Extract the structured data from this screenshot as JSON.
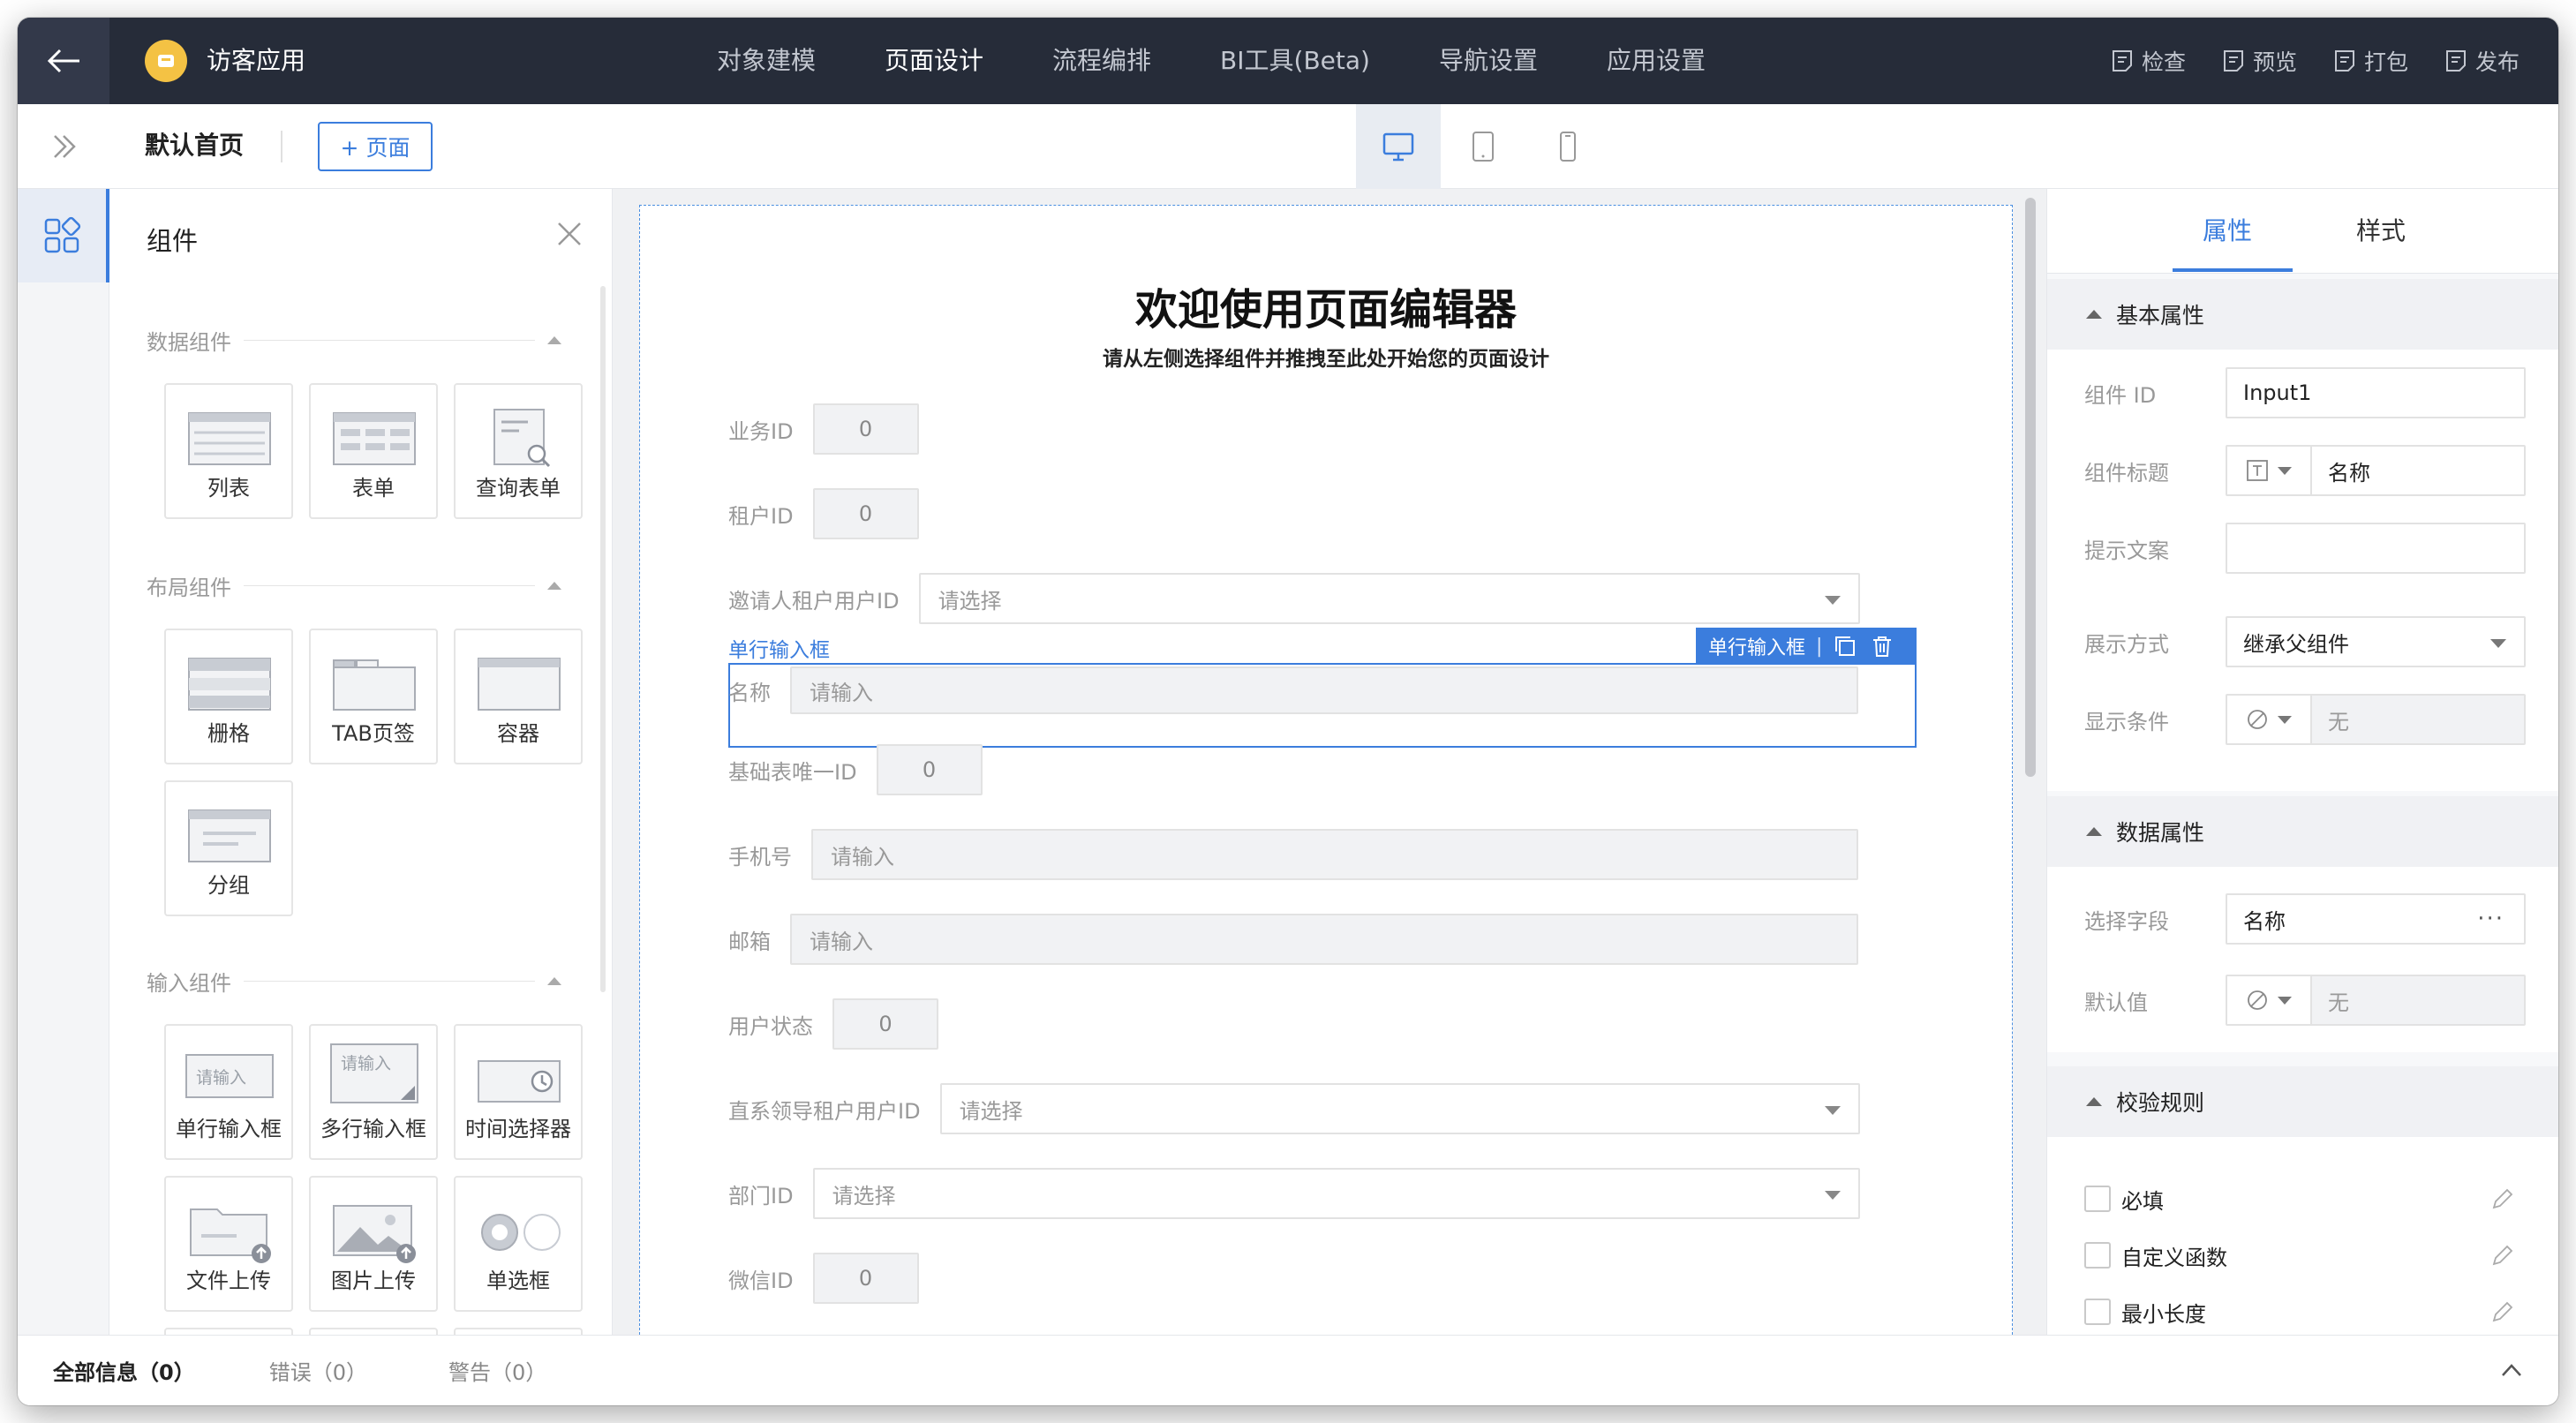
{
  "app": {
    "name": "访客应用"
  },
  "top_nav": [
    {
      "label": "对象建模",
      "active": false
    },
    {
      "label": "页面设计",
      "active": true
    },
    {
      "label": "流程编排",
      "active": false
    },
    {
      "label": "BI工具(Beta)",
      "active": false
    },
    {
      "label": "导航设置",
      "active": false
    },
    {
      "label": "应用设置",
      "active": false
    }
  ],
  "top_actions": [
    "检查",
    "预览",
    "打包",
    "发布"
  ],
  "subbar": {
    "page_name": "默认首页",
    "add_page_label": "+ 页面",
    "devices": [
      "desktop-icon",
      "tablet-icon",
      "mobile-icon"
    ]
  },
  "components_panel": {
    "title": "组件",
    "sections": [
      {
        "name": "数据组件",
        "items": [
          "列表",
          "表单",
          "查询表单"
        ]
      },
      {
        "name": "布局组件",
        "items": [
          "栅格",
          "TAB页签",
          "容器",
          "分组"
        ]
      },
      {
        "name": "输入组件",
        "items": [
          "单行输入框",
          "多行输入框",
          "时间选择器",
          "文件上传",
          "图片上传",
          "单选框"
        ]
      }
    ],
    "input_placeholder": "请输入"
  },
  "canvas": {
    "title": "欢迎使用页面编辑器",
    "subtitle": "请从左侧选择组件并推拽至此处开始您的页面设计",
    "selected_component_label": "单行输入框",
    "selected_toolbar_label": "单行输入框",
    "fields": [
      {
        "label": "业务ID",
        "kind": "number",
        "value": "0"
      },
      {
        "label": "租户ID",
        "kind": "number",
        "value": "0"
      },
      {
        "label": "邀请人租户用户ID",
        "kind": "select",
        "value": "请选择"
      },
      {
        "label": "名称",
        "kind": "text",
        "value": "请输入"
      },
      {
        "label": "基础表唯一ID",
        "kind": "number",
        "value": "0"
      },
      {
        "label": "手机号",
        "kind": "text",
        "value": "请输入"
      },
      {
        "label": "邮箱",
        "kind": "text",
        "value": "请输入"
      },
      {
        "label": "用户状态",
        "kind": "number",
        "value": "0"
      },
      {
        "label": "直系领导租户用户ID",
        "kind": "select",
        "value": "请选择"
      },
      {
        "label": "部门ID",
        "kind": "select",
        "value": "请选择"
      },
      {
        "label": "微信ID",
        "kind": "number",
        "value": "0"
      }
    ]
  },
  "properties": {
    "tabs": [
      "属性",
      "样式"
    ],
    "active_tab": "属性",
    "basic": {
      "section": "基本属性",
      "component_id_label": "组件 ID",
      "component_id_value": "Input1",
      "title_label": "组件标题",
      "title_value": "名称",
      "hint_label": "提示文案",
      "hint_value": "",
      "display_label": "展示方式",
      "display_value": "继承父组件",
      "condition_label": "显示条件",
      "condition_value": "无"
    },
    "data": {
      "section": "数据属性",
      "field_label": "选择字段",
      "field_value": "名称",
      "more": "···",
      "default_label": "默认值",
      "default_value": "无"
    },
    "rules": {
      "section": "校验规则",
      "items": [
        "必填",
        "自定义函数",
        "最小长度"
      ]
    }
  },
  "bottombar": {
    "tabs": [
      "全部信息（0）",
      "错误（0）",
      "警告（0）"
    ]
  },
  "colors": {
    "topbar": "#262c39",
    "accent": "#3b7ddd",
    "logo": "#f4c244"
  }
}
